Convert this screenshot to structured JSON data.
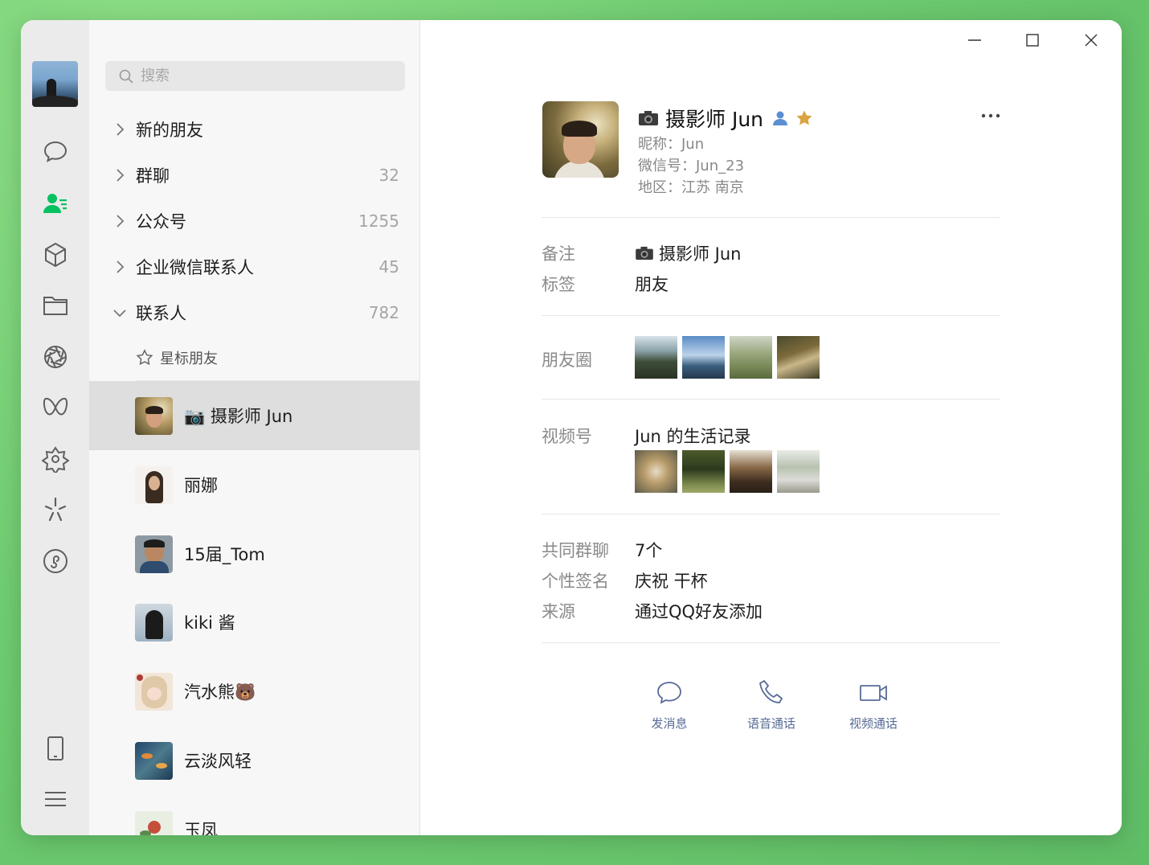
{
  "search": {
    "placeholder": "搜索"
  },
  "groups": [
    {
      "label": "新的朋友",
      "count": ""
    },
    {
      "label": "群聊",
      "count": "32"
    },
    {
      "label": "公众号",
      "count": "1255"
    },
    {
      "label": "企业微信联系人",
      "count": "45"
    },
    {
      "label": "联系人",
      "count": "782"
    }
  ],
  "starred_label": "星标朋友",
  "contacts": [
    {
      "name": "📷 摄影师 Jun",
      "selected": true
    },
    {
      "name": "丽娜"
    },
    {
      "name": "15届_Tom"
    },
    {
      "name": "kiki 酱"
    },
    {
      "name": "汽水熊🐻"
    },
    {
      "name": "云淡风轻"
    },
    {
      "name": "玉凤"
    }
  ],
  "profile": {
    "name": "摄影师 Jun",
    "nickname_line": "昵称：Jun",
    "wechat_id_line": "微信号：Jun_23",
    "region_line": "地区：江苏 南京"
  },
  "fields": {
    "remark_label": "备注",
    "remark_value": "摄影师 Jun",
    "tag_label": "标签",
    "tag_value": "朋友",
    "moments_label": "朋友圈",
    "channels_label": "视频号",
    "channels_value": "Jun 的生活记录",
    "groups_label": "共同群聊",
    "groups_value": "7个",
    "signature_label": "个性签名",
    "signature_value": "庆祝 干杯",
    "source_label": "来源",
    "source_value": "通过QQ好友添加"
  },
  "actions": {
    "message": "发消息",
    "voice": "语音通话",
    "video": "视频通话"
  },
  "colors": {
    "accent_green": "#07c160",
    "link_blue": "#576b95",
    "star_gold": "#d9a441"
  }
}
